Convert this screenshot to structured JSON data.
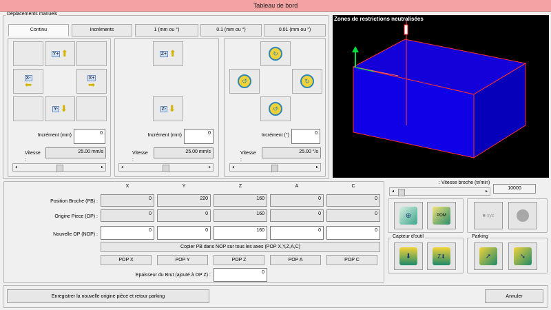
{
  "window": {
    "title": "Tableau de bord"
  },
  "manual": {
    "group_label": "Déplacements manuels",
    "tabs": [
      "Continu",
      "Incréments",
      "1 (mm ou °)",
      "0.1 (mm ou °)",
      "0.01 (mm ou °)"
    ],
    "xy": {
      "increment_label": "Incrément (mm)",
      "increment_value": "0",
      "speed_label": "Vitesse :",
      "speed_value": "25.00 mm/s",
      "buttons": [
        "Y+",
        "X-",
        "X+",
        "Y-"
      ]
    },
    "z": {
      "increment_label": "Incrément (mm)",
      "increment_value": "0",
      "speed_label": "Vitesse :",
      "speed_value": "25.00 mm/s",
      "buttons": [
        "Z+",
        "Z-"
      ]
    },
    "rot": {
      "increment_label": "Incrément (°)",
      "increment_value": "0",
      "speed_label": "Vitesse :",
      "speed_value": "25.00 °/s"
    }
  },
  "viewer": {
    "label": "Zones de restrictions neutralisées"
  },
  "positions": {
    "columns": [
      "X",
      "Y",
      "Z",
      "A",
      "C"
    ],
    "rows": [
      {
        "label": "Position Broche  (PB) :",
        "values": [
          "0",
          "220",
          "160",
          "0",
          "0"
        ]
      },
      {
        "label": "Origine Piece (OP) :",
        "values": [
          "0",
          "0",
          "160",
          "0",
          "0"
        ]
      },
      {
        "label": "Nouvelle OP (NOP) :",
        "values": [
          "0",
          "0",
          "160",
          "0",
          "0"
        ]
      }
    ],
    "copy_button": "Copier PB dans NOP sur tous les axes (POP X,Y,Z,A,C)",
    "pop_buttons": [
      "POP X",
      "POP Y",
      "POP Z",
      "POP A",
      "POP C"
    ],
    "stock_label": "Epaisseur du Brut (ajouté à OP Z) :",
    "stock_value": "0"
  },
  "spindle": {
    "label": ": Vitesse broche (tr/min)",
    "value": "10000"
  },
  "tool_sensor": {
    "label": "Capteur d'outil"
  },
  "parking": {
    "label": "Parking"
  },
  "footer": {
    "save_button": "Enregistrer la nouvelle origine pièce et retour parking",
    "cancel_button": "Annuler"
  }
}
